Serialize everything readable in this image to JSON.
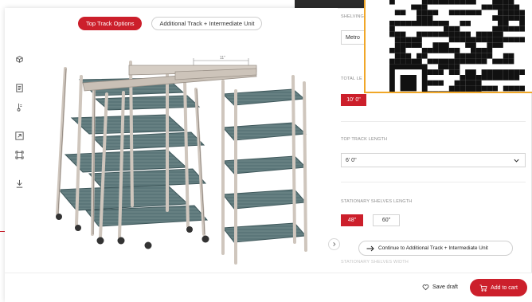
{
  "viewer": {
    "tabs": [
      {
        "label": "Top Track Options",
        "active": true
      },
      {
        "label": "Additional Track + Intermediate Unit",
        "active": false
      }
    ],
    "toolbar": [
      "ar-icon",
      "document-icon",
      "thermometer-icon",
      "expand-icon",
      "dimensions-icon",
      "download-icon"
    ],
    "dimension_label": "11\""
  },
  "options": {
    "shelving_label": "SHELVING",
    "shelving_value": "Metro",
    "total_length_label": "TOTAL LE",
    "total_length_selected": "10' 0\"",
    "top_track_length_label": "TOP TRACK LENGTH",
    "top_track_length_value": "6' 0\"",
    "stationary_shelves_length_label": "STATIONARY SHELVES LENGTH",
    "stationary_shelves_options": [
      {
        "label": "48\"",
        "selected": true
      },
      {
        "label": "60\"",
        "selected": false
      }
    ],
    "stationary_shelves_width_label": "STATIONARY SHELVES WIDTH",
    "continue_label": "Continue to Additional Track + Intermediate Unit"
  },
  "footer": {
    "save_draft_label": "Save draft",
    "add_to_cart_label": "Add to cart"
  },
  "colors": {
    "accent": "#cc1f2b",
    "qr_border": "#f0a728",
    "shelf": "#4f6b6e",
    "post": "#cfc6bd"
  }
}
